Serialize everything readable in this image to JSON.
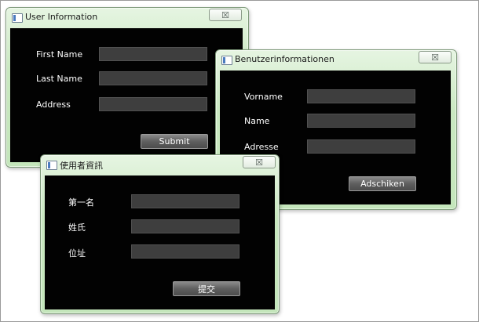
{
  "windows": {
    "english": {
      "title": "User Information",
      "close_glyph": "☒",
      "labels": [
        "First Name",
        "Last Name",
        "Address"
      ],
      "submit_label": "Submit"
    },
    "german": {
      "title": "Benutzerinformationen",
      "close_glyph": "☒",
      "labels": [
        "Vorname",
        "Name",
        "Adresse"
      ],
      "submit_label": "Adschiken"
    },
    "chinese": {
      "title": "使用者資訊",
      "close_glyph": "☒",
      "labels": [
        "第一名",
        "姓氏",
        "位址"
      ],
      "submit_label": "提交"
    }
  }
}
